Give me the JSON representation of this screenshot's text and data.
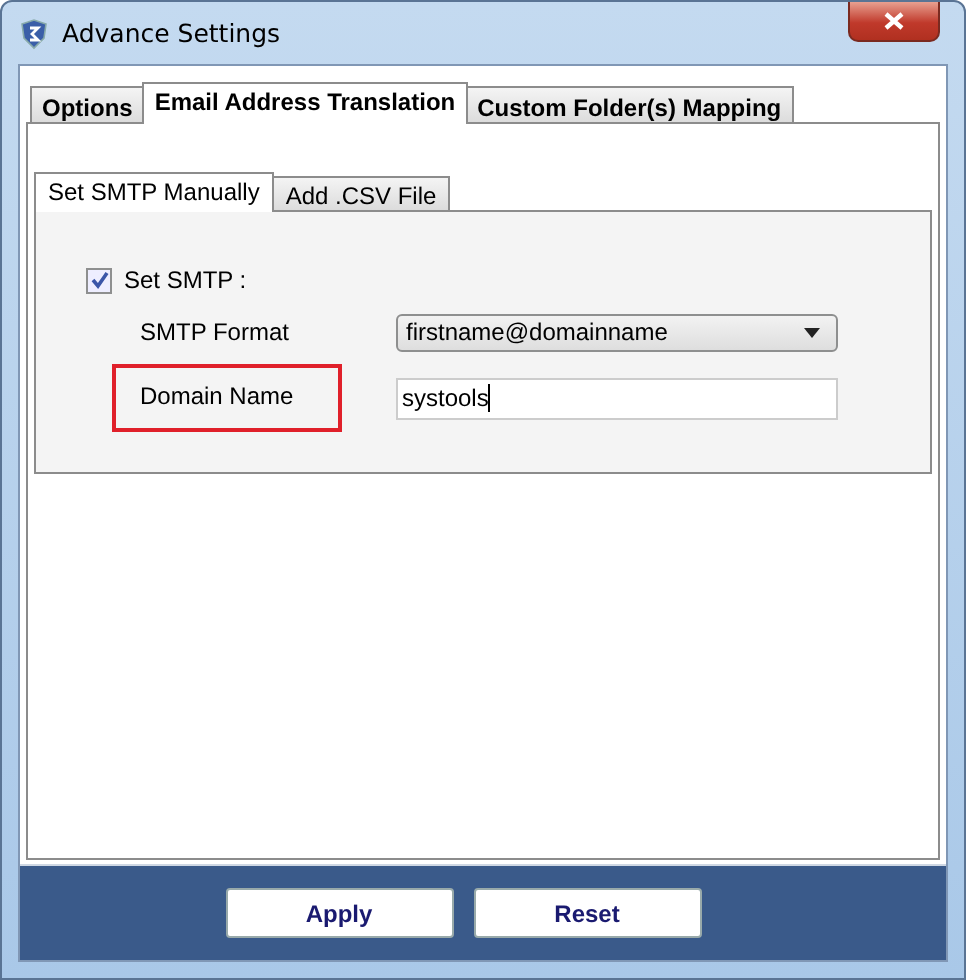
{
  "window": {
    "title": "Advance Settings"
  },
  "tabs": [
    {
      "label": "Options",
      "selected": false
    },
    {
      "label": "Email Address Translation",
      "selected": true
    },
    {
      "label": "Custom Folder(s) Mapping",
      "selected": false
    }
  ],
  "subtabs": [
    {
      "label": "Set SMTP Manually",
      "selected": true
    },
    {
      "label": "Add .CSV File",
      "selected": false
    }
  ],
  "set_smtp": {
    "label": "Set SMTP :",
    "checked": true
  },
  "fields": [
    {
      "kind": "dropdown",
      "label": "SMTP Format",
      "value": "firstname@domainname",
      "highlighted": false
    },
    {
      "kind": "text",
      "label": "Domain Name",
      "value": "systools",
      "highlighted": true
    }
  ],
  "buttons": [
    "Apply",
    "Reset"
  ]
}
